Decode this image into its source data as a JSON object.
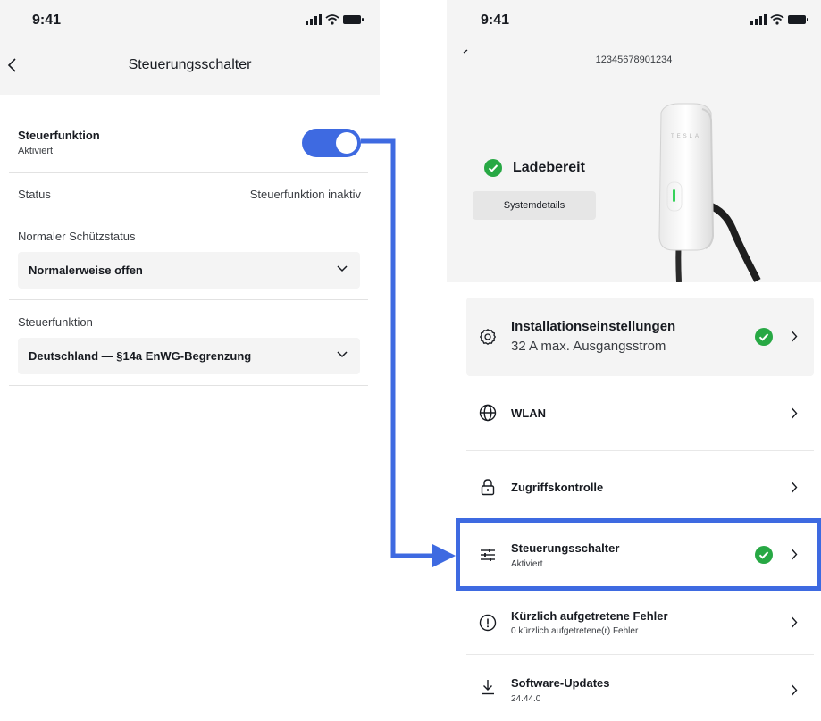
{
  "left": {
    "status_bar": {
      "time": "9:41"
    },
    "header": {
      "title": "Steuerungsschalter"
    },
    "toggle_row": {
      "title": "Steuerfunktion",
      "subtitle": "Aktiviert",
      "enabled": true
    },
    "status_row": {
      "label": "Status",
      "value": "Steuerfunktion inaktiv"
    },
    "contactor_section": {
      "label": "Normaler Schützstatus",
      "selected": "Normalerweise offen"
    },
    "function_section": {
      "label": "Steuerfunktion",
      "selected": "Deutschland — §14a EnWG-Begrenzung"
    }
  },
  "right": {
    "status_bar": {
      "time": "9:41"
    },
    "serial_number": "12345678901234",
    "charger": {
      "status": "Ladebereit",
      "details_button": "Systemdetails",
      "brand_text": "TESLA"
    },
    "menu": [
      {
        "key": "install",
        "title": "Installationseinstellungen",
        "subtitle": "32 A max. Ausgangsstrom",
        "icon": "gear-icon",
        "status": "ok"
      },
      {
        "key": "wlan",
        "title": "WLAN",
        "subtitle": "",
        "icon": "globe-icon"
      },
      {
        "key": "access",
        "title": "Zugriffskontrolle",
        "subtitle": "",
        "icon": "lock-icon"
      },
      {
        "key": "switch",
        "title": "Steuerungsschalter",
        "subtitle": "Aktiviert",
        "icon": "sliders-icon",
        "status": "ok"
      },
      {
        "key": "errors",
        "title": "Kürzlich aufgetretene Fehler",
        "subtitle": "0 kürzlich aufgetretene(r) Fehler",
        "icon": "alert-icon"
      },
      {
        "key": "updates",
        "title": "Software-Updates",
        "subtitle": "24.44.0",
        "icon": "download-icon"
      }
    ]
  },
  "colors": {
    "accent_blue": "#3e6ae1",
    "success_green": "#27a844",
    "panel_gray": "#f4f4f4",
    "text_primary": "#171a20"
  }
}
